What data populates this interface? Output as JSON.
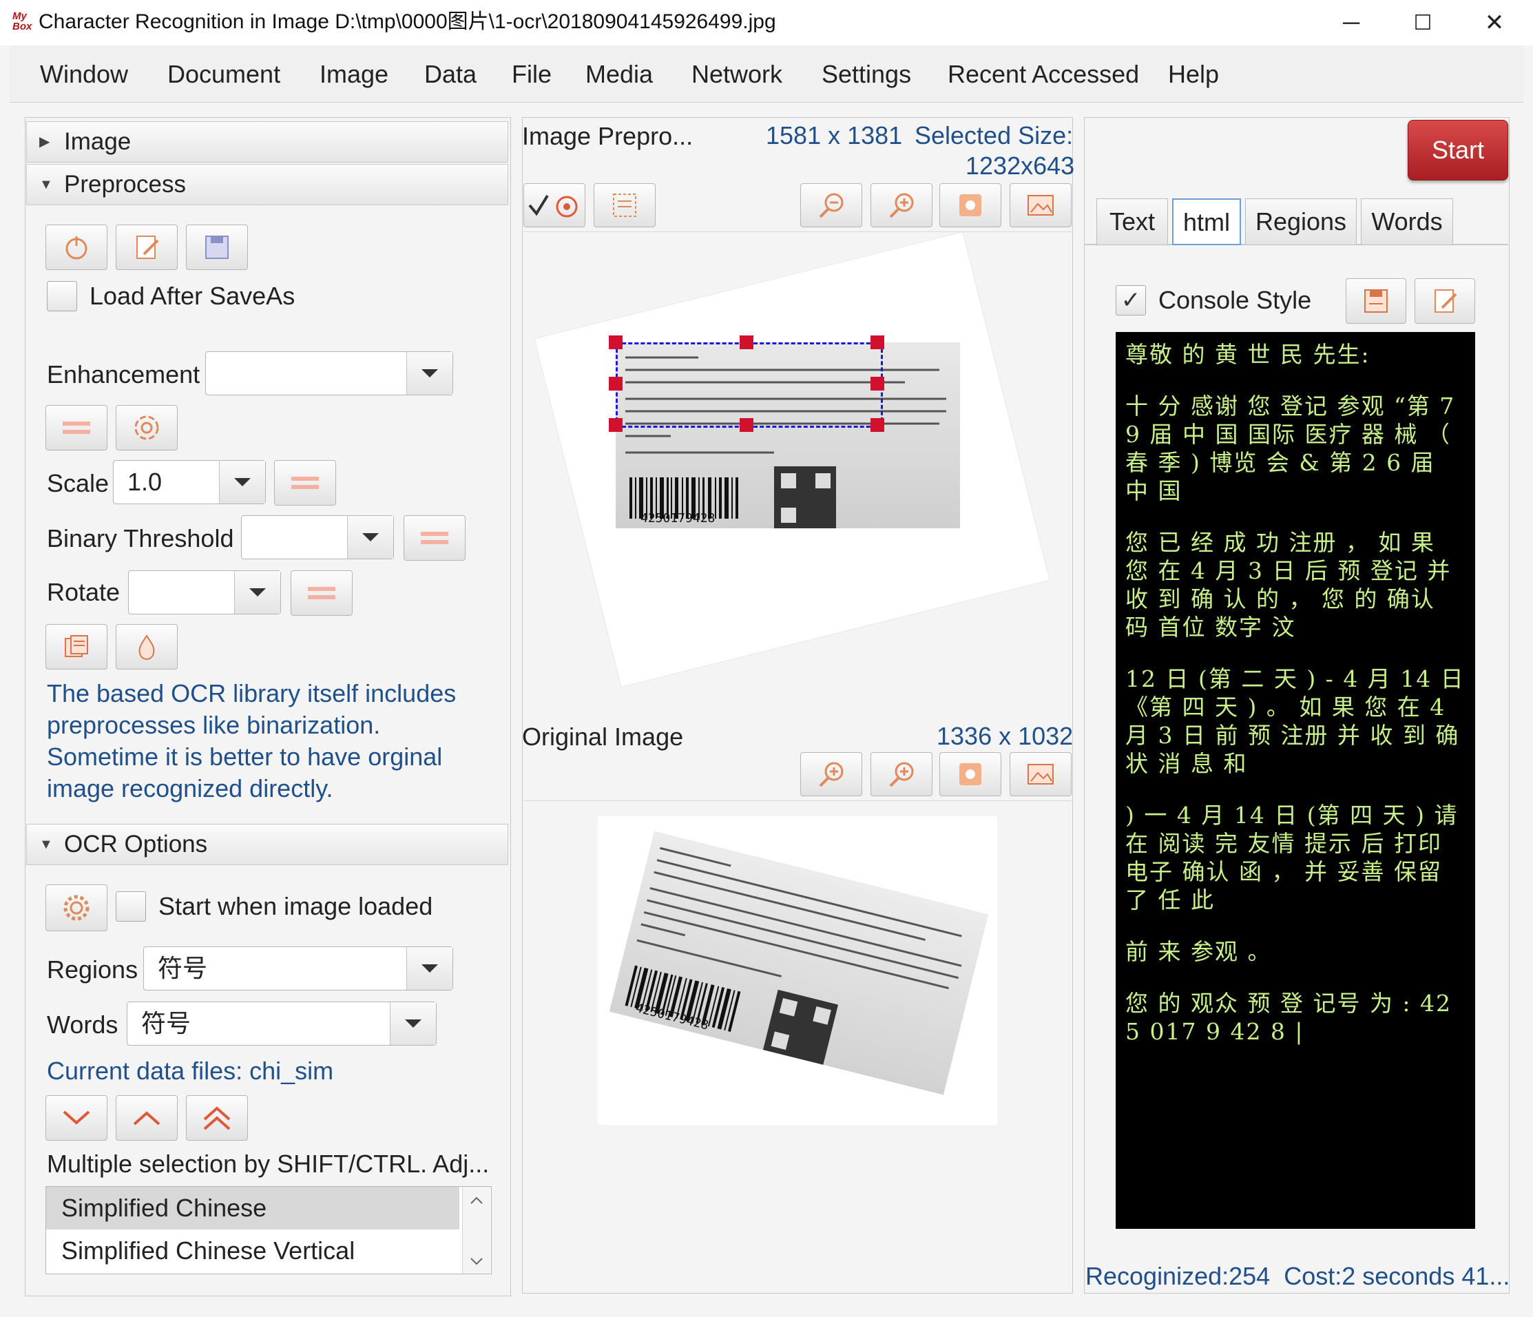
{
  "window": {
    "logo_text": "MyBox",
    "title": "Character Recognition in Image D:\\tmp\\0000图片\\1-ocr\\20180904145926499.jpg",
    "minimize": "─",
    "maximize": "☐",
    "close": "✕"
  },
  "menu": [
    "Window",
    "Document",
    "Image",
    "Data",
    "File",
    "Media",
    "Network",
    "Settings",
    "Recent Accessed",
    "Help"
  ],
  "left_panel": {
    "image_section": "Image",
    "preprocess_section": "Preprocess",
    "load_after_saveas": "Load After SaveAs",
    "enhancement_label": "Enhancement",
    "enhancement_value": "",
    "scale_label": "Scale",
    "scale_value": "1.0",
    "binary_threshold_label": "Binary Threshold",
    "binary_threshold_value": "",
    "rotate_label": "Rotate",
    "rotate_value": "",
    "note_lines": [
      "The based OCR library itself includes",
      "preprocesses like binarization.",
      "Sometime it is better to have orginal",
      "image recognized directly."
    ],
    "ocr_options_section": "OCR Options",
    "start_when_loaded": "Start when image loaded",
    "regions_label": "Regions",
    "regions_value": "符号",
    "words_label": "Words",
    "words_value": "符号",
    "current_data_files": "Current data files: chi_sim",
    "multi_selection_hint": "Multiple selection by SHIFT/CTRL. Adj...",
    "languages": [
      "Simplified Chinese",
      "Simplified Chinese Vertical"
    ]
  },
  "middle_panel": {
    "preprocessed_title": "Image Prepro...",
    "preprocessed_size": "1581 x 1381",
    "selected_size_label": "Selected Size:",
    "selected_size": "1232x643",
    "original_title": "Original Image",
    "original_size": "1336 x 1032",
    "barcode_number": "4250179428"
  },
  "right_panel": {
    "start_button": "Start",
    "tabs": [
      "Text",
      "html",
      "Regions",
      "Words"
    ],
    "active_tab": "html",
    "console_style": "Console Style",
    "console_paragraphs": [
      "尊敬 的 黄 世 民 先生:",
      "十 分 感谢 您 登记 参观 “第 7 9 届 中 国 国际 医疗 器 械 （ 春 季 ) 博览 会 & 第 2 6 届 中 国",
      "您 已 经 成 功 注册 ， 如 果 您 在 4 月 3 日 后 预 登记 并 收 到 确 认 的 ， 您 的 确认 码 首位 数字 汶",
      "12 日 (第 二 天 ) - 4 月 14 日 《第 四 天 ) 。 如 果 您 在 4 月 3 日 前 预 注册 并 收 到 确 状 消 息 和",
      ") 一 4 月 14 日 (第 四 天 ) 请 在 阅读 完 友情 提示 后 打印 电子 确认 函 ， 并 妥善 保留 了 任 此",
      "前 来 参观 。",
      "您 的 观众 预 登 记号 为 : 42 5 017 9 42 8 |"
    ],
    "status": "Recoginized:254  Cost:2 seconds 41..."
  },
  "colors": {
    "accent_red": "#c0272d",
    "console_bg": "#000000",
    "console_text": "#c8f08a",
    "link_blue": "#20508a",
    "selection_blue": "#1a1ad8",
    "handle_red": "#d0102c"
  }
}
